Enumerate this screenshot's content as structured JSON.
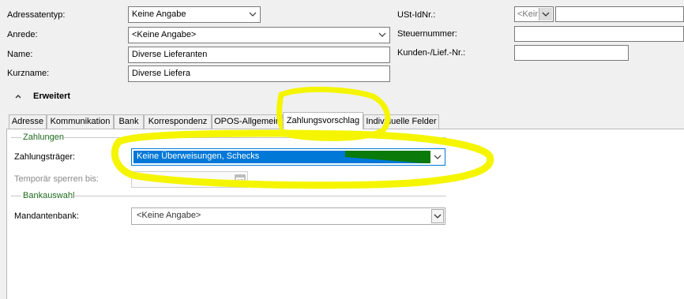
{
  "header": {
    "adressatentyp": {
      "label": "Adressatentyp:",
      "value": "Keine Angabe"
    },
    "anrede": {
      "label": "Anrede:",
      "value": "<Keine Angabe>"
    },
    "name": {
      "label": "Name:",
      "value": "Diverse Lieferanten"
    },
    "kurzname": {
      "label": "Kurzname:",
      "value": "Diverse Liefera"
    },
    "ust_idnr": {
      "label": "USt-IdNr.:",
      "prefix_value": "<Keir",
      "value": ""
    },
    "steuernummer": {
      "label": "Steuernummer:",
      "value": ""
    },
    "kunden_lief_nr": {
      "label": "Kunden-/Lief.-Nr.:",
      "value": ""
    }
  },
  "erweitert": {
    "label": "Erweitert",
    "icon": "chevron-up-icon"
  },
  "tabs": [
    {
      "label": "Adresse",
      "active": false
    },
    {
      "label": "Kommunikation",
      "active": false
    },
    {
      "label": "Bank",
      "active": false
    },
    {
      "label": "Korrespondenz",
      "active": false
    },
    {
      "label": "OPOS-Allgemein",
      "active": false
    },
    {
      "label": "Zahlungsvorschlag",
      "active": true
    },
    {
      "label": "Individuelle Felder",
      "active": false
    }
  ],
  "zahlungen": {
    "title": "Zahlungen",
    "zahlungstraeger": {
      "label": "Zahlungsträger:",
      "value": "Keine Überweisungen, Schecks"
    },
    "temporaer_sperren": {
      "label": "Temporär sperren bis:",
      "value": "",
      "icon": "calendar-icon"
    }
  },
  "bankauswahl": {
    "title": "Bankauswahl",
    "mandantenbank": {
      "label": "Mandantenbank:",
      "value": "<Keine Angabe>"
    }
  },
  "colors": {
    "highlight_yellow": "#f5f500",
    "selection_blue": "#0078d7",
    "group_green": "#1e6b1e",
    "marker_green": "#0a7a0a"
  }
}
